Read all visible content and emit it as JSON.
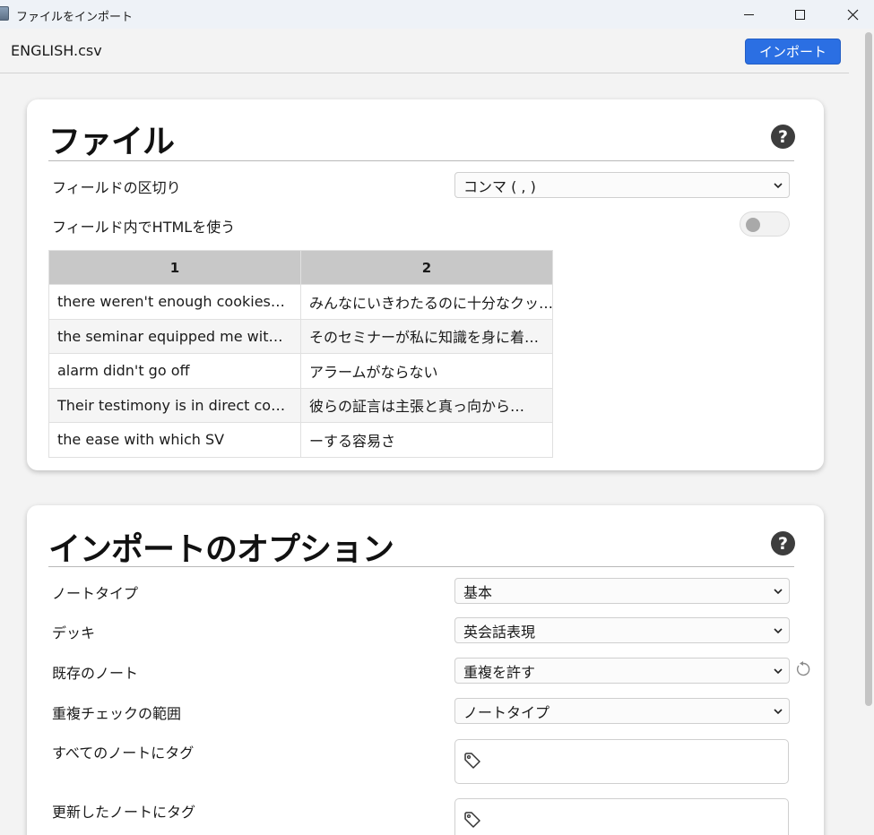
{
  "window": {
    "title": "ファイルをインポート",
    "filename": "ENGLISH.csv",
    "import_label": "インポート"
  },
  "file_section": {
    "title": "ファイル",
    "delimiter_label": "フィールドの区切り",
    "delimiter_value": "コンマ ( , )",
    "html_label": "フィールド内でHTMLを使う",
    "html_enabled": false,
    "table": {
      "headers": [
        "1",
        "2"
      ],
      "rows": [
        [
          "there weren't enough cookies…",
          "みんなにいきわたるのに十分なクッ…"
        ],
        [
          "the seminar equipped me wit…",
          "そのセミナーが私に知識を身に着…"
        ],
        [
          "alarm didn't go off",
          "アラームがならない"
        ],
        [
          "Their testimony is in direct co…",
          "彼らの証言は主張と真っ向から…"
        ],
        [
          "the ease with which SV",
          "ーする容易さ"
        ]
      ]
    }
  },
  "options_section": {
    "title": "インポートのオプション",
    "notetype_label": "ノートタイプ",
    "notetype_value": "基本",
    "deck_label": "デッキ",
    "deck_value": "英会話表現",
    "existing_label": "既存のノート",
    "existing_value": "重複を許す",
    "dupscope_label": "重複チェックの範囲",
    "dupscope_value": "ノートタイプ",
    "tag_all_label": "すべてのノートにタグ",
    "tag_updated_label": "更新したノートにタグ"
  },
  "colors": {
    "accent": "#2b6fe3",
    "header_cell": "#c8c8c8"
  },
  "icons": {
    "help": "question-circle-icon",
    "chevron": "chevron-down-icon",
    "tag": "tag-icon",
    "reset": "reset-icon"
  }
}
